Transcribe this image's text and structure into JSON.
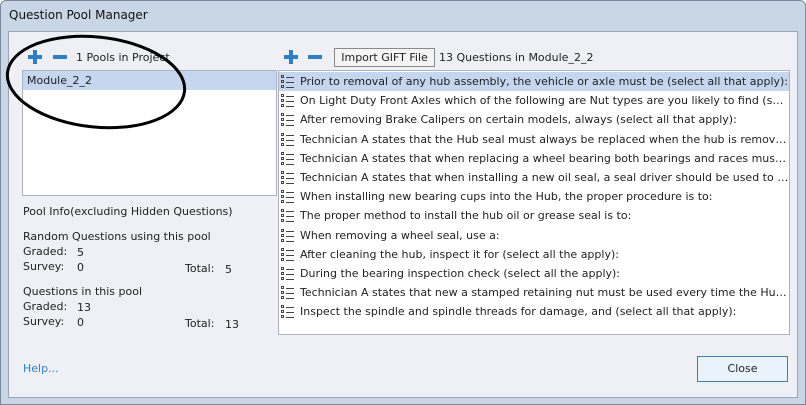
{
  "window": {
    "title": "Question Pool Manager"
  },
  "pools": {
    "count_label": "1 Pools in Project",
    "items": [
      "Module_2_2"
    ],
    "selected": 0
  },
  "pool_info": {
    "heading": "Pool Info(excluding Hidden Questions)",
    "random_heading": "Random Questions using this pool",
    "random": {
      "graded_label": "Graded:",
      "graded": "5",
      "survey_label": "Survey:",
      "survey": "0",
      "total_label": "Total:",
      "total": "5"
    },
    "questions_heading": "Questions in this pool",
    "questions": {
      "graded_label": "Graded:",
      "graded": "13",
      "survey_label": "Survey:",
      "survey": "0",
      "total_label": "Total:",
      "total": "13"
    }
  },
  "questions": {
    "import_label": "Import GIFT File",
    "count_label": "13 Questions in Module_2_2",
    "items": [
      "Prior to removal of any hub assembly, the vehicle or axle must be (select all that apply):",
      "On Light Duty Front Axles which of the following are Nut types are you likely to find (select a...",
      "After removing Brake Calipers on certain models, always (select all that apply):",
      "Technician A states that the Hub seal must always be replaced when the hub is removed. Tech...",
      "Technician A states that when replacing a wheel bearing both bearings and races must be rep...",
      "Technician A states that when installing a new oil seal, a seal driver should be used to install...",
      "When installing new bearing cups into the Hub, the proper procedure is to:",
      "The proper method to install the hub oil or grease seal is to:",
      "When removing a wheel seal, use a:",
      "After cleaning the hub, inspect it for (select all the apply):",
      "During the bearing inspection check (select all the apply):",
      "Technician A states that new a stamped retaining nut must be used every time the Hub is re...",
      "Inspect the spindle and spindle threads for damage, and (select all that apply):"
    ],
    "selected": 0
  },
  "footer": {
    "help_label": "Help...",
    "close_label": "Close"
  },
  "colors": {
    "accent": "#2e7fc4",
    "selection": "#c5d6ee"
  }
}
